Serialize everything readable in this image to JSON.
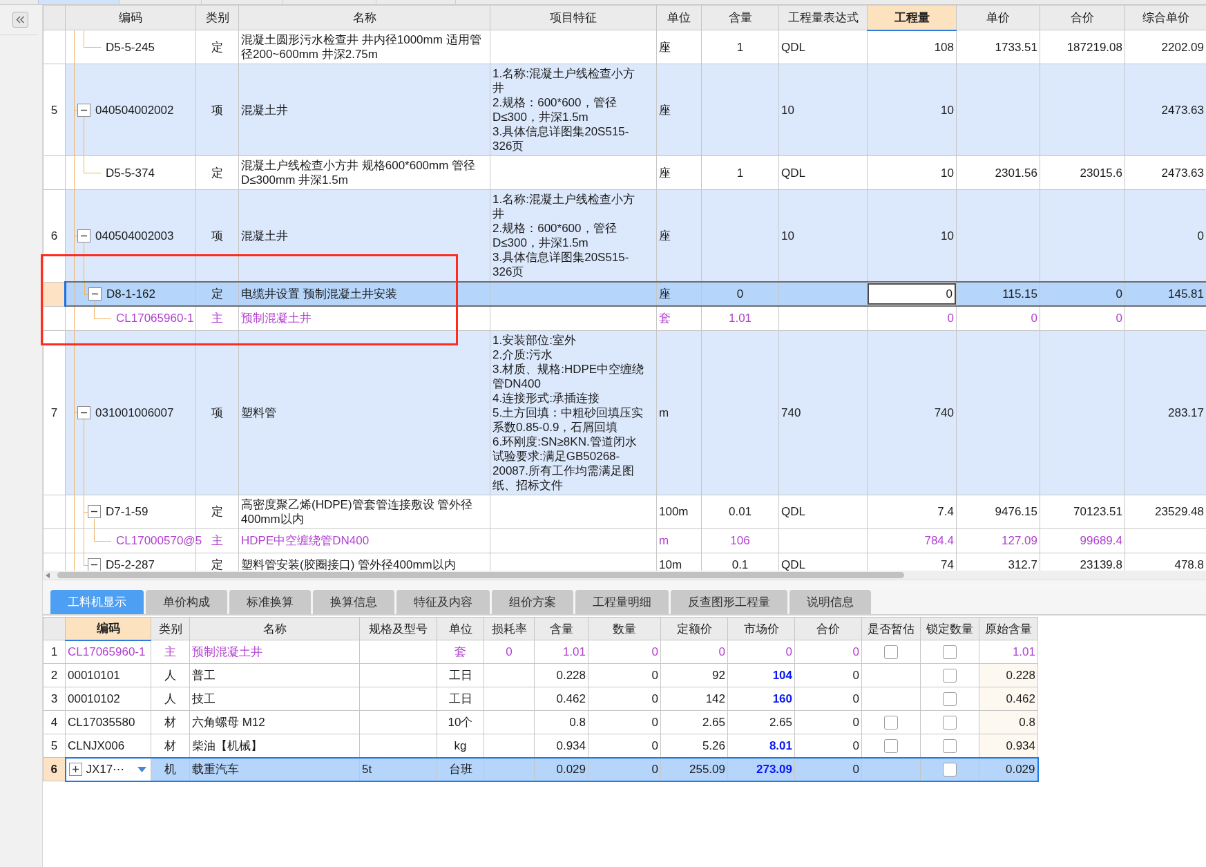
{
  "top_table": {
    "columns": [
      {
        "label": "编码",
        "selected": false
      },
      {
        "label": "类别",
        "selected": false
      },
      {
        "label": "名称",
        "selected": false
      },
      {
        "label": "项目特征",
        "selected": false
      },
      {
        "label": "单位",
        "selected": false
      },
      {
        "label": "含量",
        "selected": false
      },
      {
        "label": "工程量表达式",
        "selected": false
      },
      {
        "label": "工程量",
        "selected": true
      },
      {
        "label": "单价",
        "selected": false
      },
      {
        "label": "合价",
        "selected": false
      },
      {
        "label": "综合单价",
        "selected": false
      }
    ],
    "rows": [
      {
        "kind": "quota",
        "selected": false,
        "code": "D5-5-245",
        "type": "定",
        "name": "混凝土圆形污水检查井 井内径1000mm 适用管径200~600mm 井深2.75m",
        "unit": "座",
        "content": "1",
        "expression": "QDL",
        "quantity": "108",
        "unit_price": "1733.51",
        "total_price": "187219.08",
        "composite_price": "2202.09"
      },
      {
        "kind": "bill",
        "no": "5",
        "selected": false,
        "expanded": true,
        "code": "040504002002",
        "type": "项",
        "name": "混凝土井",
        "features": "1.名称:混凝土户线检查小方井\n2.规格：600*600，管径D≤300，井深1.5m\n3.具体信息详图集20S515-326页",
        "unit": "座",
        "expression": "10",
        "quantity": "10",
        "composite_price": "2473.63",
        "children": [
          {
            "kind": "quota",
            "selected": false,
            "code": "D5-5-374",
            "type": "定",
            "name": "混凝土户线检查小方井 规格600*600mm 管径D≤300mm 井深1.5m",
            "unit": "座",
            "content": "1",
            "expression": "QDL",
            "quantity": "10",
            "unit_price": "2301.56",
            "total_price": "23015.6",
            "composite_price": "2473.63"
          }
        ]
      },
      {
        "kind": "bill",
        "no": "6",
        "selected": false,
        "expanded": true,
        "code": "040504002003",
        "type": "项",
        "name": "混凝土井",
        "features": "1.名称:混凝土户线检查小方井\n2.规格：600*600，管径D≤300，井深1.5m\n3.具体信息详图集20S515-326页",
        "unit": "座",
        "expression": "10",
        "quantity": "10",
        "composite_price": "0",
        "children": [
          {
            "kind": "quota",
            "selected": true,
            "expanded": true,
            "code": "D8-1-162",
            "type": "定",
            "name": "电缆井设置 预制混凝土井安装",
            "unit": "座",
            "content": "0",
            "quantity": "0",
            "unit_price": "115.15",
            "total_price": "0",
            "composite_price": "145.81",
            "children": [
              {
                "kind": "main_material",
                "selected": false,
                "code": "CL17065960-1",
                "type": "主",
                "name": "预制混凝土井",
                "unit": "套",
                "content": "1.01",
                "quantity": "0",
                "unit_price": "0",
                "total_price": "0"
              }
            ]
          }
        ]
      },
      {
        "kind": "bill",
        "no": "7",
        "selected": false,
        "expanded": true,
        "code": "031001006007",
        "type": "项",
        "name": "塑料管",
        "features": "1.安装部位:室外\n2.介质:污水\n3.材质、规格:HDPE中空缠绕管DN400\n4.连接形式:承插连接\n5.土方回填：中粗砂回填压实系数0.85-0.9，石屑回填\n6.环刚度:SN≥8KN.管道闭水试验要求:满足GB50268-20087.所有工作均需满足图纸、招标文件",
        "unit": "m",
        "expression": "740",
        "quantity": "740",
        "composite_price": "283.17",
        "children": [
          {
            "kind": "quota",
            "selected": false,
            "expanded": true,
            "code": "D7-1-59",
            "type": "定",
            "name": "高密度聚乙烯(HDPE)管套管连接敷设 管外径400mm以内",
            "unit": "100m",
            "content": "0.01",
            "expression": "QDL",
            "quantity": "7.4",
            "unit_price": "9476.15",
            "total_price": "70123.51",
            "composite_price": "23529.48",
            "children": [
              {
                "kind": "main_material",
                "selected": false,
                "code": "CL17000570@5",
                "type": "主",
                "name": "HDPE中空缠绕管DN400",
                "unit": "m",
                "content": "106",
                "quantity": "784.4",
                "unit_price": "127.09",
                "total_price": "99689.4"
              }
            ]
          },
          {
            "kind": "quota",
            "selected": false,
            "expanded": true,
            "code": "D5-2-287",
            "type": "定",
            "name": "塑料管安装(胶圈接口) 管外径400mm以内",
            "unit": "10m",
            "content": "0.1",
            "expression": "QDL",
            "quantity": "74",
            "unit_price": "312.7",
            "total_price": "23139.8",
            "composite_price": "478.8"
          }
        ]
      }
    ]
  },
  "bottom_panel": {
    "tabs": [
      {
        "label": "工料机显示",
        "selected": true
      },
      {
        "label": "单价构成",
        "selected": false
      },
      {
        "label": "标准换算",
        "selected": false
      },
      {
        "label": "换算信息",
        "selected": false
      },
      {
        "label": "特征及内容",
        "selected": false
      },
      {
        "label": "组价方案",
        "selected": false
      },
      {
        "label": "工程量明细",
        "selected": false
      },
      {
        "label": "反查图形工程量",
        "selected": false
      },
      {
        "label": "说明信息",
        "selected": false
      }
    ],
    "table": {
      "columns": [
        {
          "label": "编码",
          "selected": true
        },
        {
          "label": "类别",
          "selected": false
        },
        {
          "label": "名称",
          "selected": false
        },
        {
          "label": "规格及型号",
          "selected": false
        },
        {
          "label": "单位",
          "selected": false
        },
        {
          "label": "损耗率",
          "selected": false
        },
        {
          "label": "含量",
          "selected": false
        },
        {
          "label": "数量",
          "selected": false
        },
        {
          "label": "定额价",
          "selected": false
        },
        {
          "label": "市场价",
          "selected": false
        },
        {
          "label": "合价",
          "selected": false
        },
        {
          "label": "是否暂估",
          "selected": false
        },
        {
          "label": "锁定数量",
          "selected": false
        },
        {
          "label": "原始含量",
          "selected": false
        }
      ],
      "rows": [
        {
          "no": "1",
          "kind": "main_material",
          "selected": false,
          "code": "CL17065960-1",
          "type": "主",
          "name": "预制混凝土井",
          "unit": "套",
          "loss_rate": "0",
          "content": "1.01",
          "amount": "0",
          "quota_price": "0",
          "market_price": "0",
          "price_changed": false,
          "total": "0",
          "estimate": false,
          "locked": false,
          "original_content": "1.01"
        },
        {
          "no": "2",
          "kind": "labor",
          "selected": false,
          "code": "00010101",
          "type": "人",
          "name": "普工",
          "unit": "工日",
          "content": "0.228",
          "amount": "0",
          "quota_price": "92",
          "market_price": "104",
          "price_changed": true,
          "total": "0",
          "locked": false,
          "original_content": "0.228"
        },
        {
          "no": "3",
          "kind": "labor",
          "selected": false,
          "code": "00010102",
          "type": "人",
          "name": "技工",
          "unit": "工日",
          "content": "0.462",
          "amount": "0",
          "quota_price": "142",
          "market_price": "160",
          "price_changed": true,
          "total": "0",
          "locked": false,
          "original_content": "0.462"
        },
        {
          "no": "4",
          "kind": "material",
          "selected": false,
          "code": "CL17035580",
          "type": "材",
          "name": "六角螺母 M12",
          "unit": "10个",
          "content": "0.8",
          "amount": "0",
          "quota_price": "2.65",
          "market_price": "2.65",
          "price_changed": false,
          "total": "0",
          "estimate": false,
          "locked": false,
          "original_content": "0.8"
        },
        {
          "no": "5",
          "kind": "material",
          "selected": false,
          "code": "CLNJX006",
          "type": "材",
          "name": "柴油【机械】",
          "unit": "kg",
          "content": "0.934",
          "amount": "0",
          "quota_price": "5.26",
          "market_price": "8.01",
          "price_changed": true,
          "total": "0",
          "estimate": false,
          "locked": false,
          "original_content": "0.934"
        },
        {
          "no": "6",
          "kind": "machine",
          "selected": true,
          "expanded": false,
          "code": "JX17⋯",
          "type": "机",
          "name": "载重汽车",
          "spec": "5t",
          "unit": "台班",
          "content": "0.029",
          "amount": "0",
          "quota_price": "255.09",
          "market_price": "273.09",
          "price_changed": true,
          "total": "0",
          "locked": false,
          "original_content": "0.029"
        }
      ]
    }
  }
}
